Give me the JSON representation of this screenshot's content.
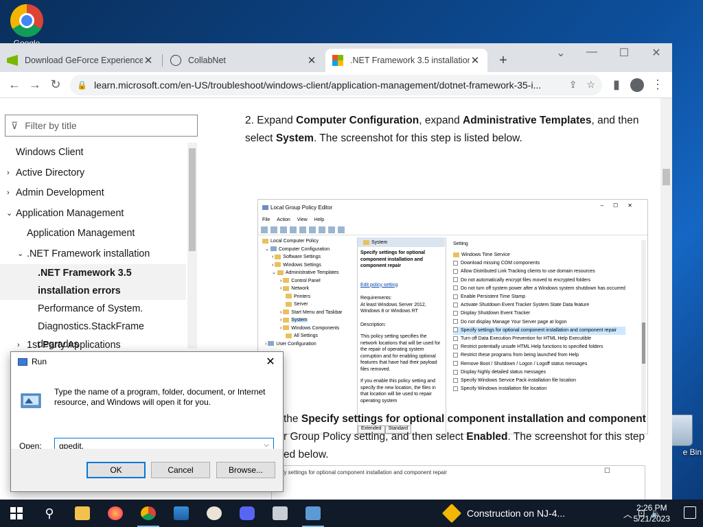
{
  "desktop": {
    "chrome_label": "Google",
    "recycle_label": "e Bin"
  },
  "browser": {
    "tabs": [
      {
        "label": "Download GeForce Experience |"
      },
      {
        "label": "CollabNet"
      },
      {
        "label": ".NET Framework 3.5 installation"
      }
    ],
    "url": "learn.microsoft.com/en-US/troubleshoot/windows-client/application-management/dotnet-framework-35-i..."
  },
  "leftnav": {
    "filter_placeholder": "Filter by title",
    "items": [
      {
        "label": "Windows Client"
      },
      {
        "label": "Active Directory"
      },
      {
        "label": "Admin Development"
      },
      {
        "label": "Application Management"
      },
      {
        "label": "Application Management"
      },
      {
        "label": ".NET Framework installation"
      },
      {
        "label": ".NET Framework 3.5 installation errors"
      },
      {
        "label": "Performance of System. Diagnostics.StackFrame degrades"
      },
      {
        "label": "1st Party Applications"
      }
    ]
  },
  "article": {
    "step2_num": "2. ",
    "step2_a": "Expand ",
    "step2_b": "Computer Configuration",
    "step2_c": ", expand ",
    "step2_d": "Administrative Templates",
    "step2_e": ", and then select ",
    "step2_f": "System",
    "step2_g": ". The screenshot for this step is listed below.",
    "step3_a": " the ",
    "step3_b": "Specify settings for optional component installation and component",
    "step3_c": "r Group Policy setting, and then select ",
    "step3_d": "Enabled",
    "step3_e": ". The screenshot for this step",
    "step3_f": "ed below.",
    "snip_text": "ecify settings for optional component installation and component repair"
  },
  "gpe": {
    "title": "Local Group Policy Editor",
    "menu": [
      "File",
      "Action",
      "View",
      "Help"
    ],
    "tree": [
      "Local Computer Policy",
      "Computer Configuration",
      "Software Settings",
      "Windows Settings",
      "Administrative Templates",
      "Control Panel",
      "Network",
      "Printers",
      "Server",
      "Start Menu and Taskbar",
      "System",
      "Windows Components",
      "All Settings",
      "User Configuration"
    ],
    "mid_header": "System",
    "mid_title": "Specify settings for optional component installation and component repair",
    "mid_edit": "Edit policy setting",
    "mid_req": "Requirements:",
    "mid_req_val": "At least Windows Server 2012, Windows 8 or Windows RT",
    "mid_desc": "Description:",
    "mid_desc_val": "This policy setting specifies the network locations that will be used for the repair of operating system corruption and for enabling optional features that have had their payload files removed.",
    "mid_desc_val2": "If you enable this policy setting and specify the new location, the files in that location will be used to repair operating system",
    "right_header": "Setting",
    "settings": [
      "Windows Time Service",
      "Download missing COM components",
      "Allow Distributed Link Tracking clients to use domain resources",
      "Do not automatically encrypt files moved to encrypted folders",
      "Do not turn off system power after a Windows system shutdown has occurred",
      "Enable Persistent Time Stamp",
      "Activate Shutdown Event Tracker System State Data feature",
      "Display Shutdown Event Tracker",
      "Do not display Manage Your Server page at logon",
      "Specify settings for optional component installation and component repair",
      "Turn off Data Execution Prevention for HTML Help Executible",
      "Restrict potentially unsafe HTML Help functions to specified folders",
      "Restrict these programs from being launched from Help",
      "Remove Boot / Shutdown / Logon / Logoff status messages",
      "Display highly detailed status messages",
      "Specify Windows Service Pack installation file location",
      "Specify Windows installation file location"
    ],
    "tabs": [
      "Extended",
      "Standard"
    ]
  },
  "run": {
    "title": "Run",
    "prompt": "Type the name of a program, folder, document, or Internet resource, and Windows will open it for you.",
    "open_label": "Open:",
    "value": "gpedit.",
    "ok": "OK",
    "cancel": "Cancel",
    "browse": "Browse..."
  },
  "taskbar": {
    "news": "Construction on NJ-4...",
    "time": "2:26 PM",
    "date": "5/21/2023"
  }
}
